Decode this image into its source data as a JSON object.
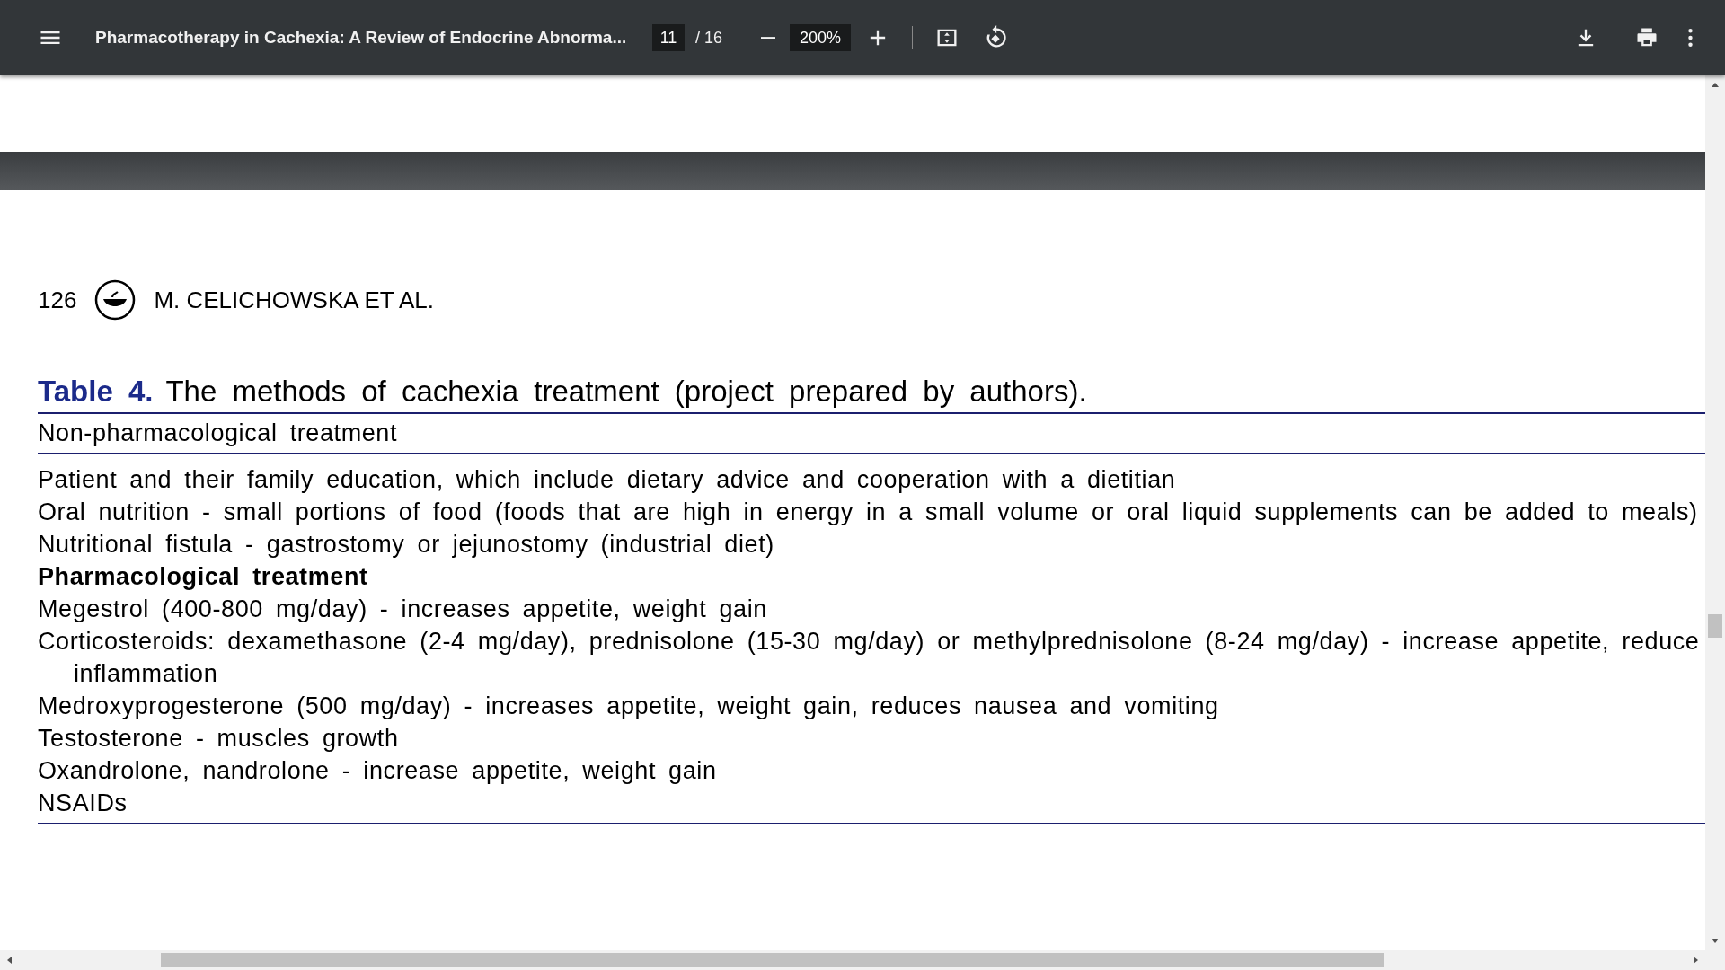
{
  "toolbar": {
    "title": "Pharmacotherapy in Cachexia: A Review of Endocrine Abnorma...",
    "page_input": "11",
    "page_total": "/ 16",
    "zoom": "200%"
  },
  "page": {
    "page_number": "126",
    "running_head": "M. CELICHOWSKA ET AL.",
    "table": {
      "label": "Table 4.",
      "caption": "The methods of cachexia treatment (project prepared by authors).",
      "heading": "Non-pharmacological treatment",
      "rows": [
        {
          "kind": "entry",
          "text": "Patient and their family education, which include dietary advice and cooperation with a dietitian"
        },
        {
          "kind": "entry",
          "text": "Oral nutrition - small portions of food (foods that are high in energy in a small volume or oral liquid supplements can be added to meals)"
        },
        {
          "kind": "entry",
          "text": "Nutritional fistula - gastrostomy or jejunostomy (industrial diet)"
        },
        {
          "kind": "subheading",
          "text": "Pharmacological treatment"
        },
        {
          "kind": "entry",
          "text": "Megestrol (400-800 mg/day) - increases appetite, weight gain"
        },
        {
          "kind": "entry",
          "text": "Corticosteroids: dexamethasone (2-4 mg/day), prednisolone (15-30 mg/day) or methylprednisolone (8-24 mg/day) - increase appetite, reduce inflammation"
        },
        {
          "kind": "entry",
          "text": "Medroxyprogesterone (500 mg/day) - increases appetite, weight gain, reduces nausea and vomiting"
        },
        {
          "kind": "entry",
          "text": "Testosterone - muscles growth"
        },
        {
          "kind": "entry",
          "text": "Oxandrolone, nandrolone - increase appetite, weight gain"
        },
        {
          "kind": "entry",
          "text": "NSAIDs"
        }
      ]
    }
  }
}
